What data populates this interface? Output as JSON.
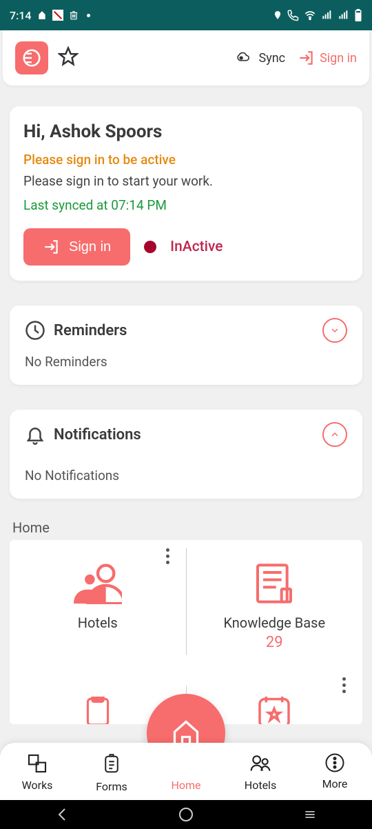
{
  "status": {
    "time": "7:14"
  },
  "header": {
    "sync_label": "Sync",
    "signin_label": "Sign in"
  },
  "greeting_card": {
    "greeting": "Hi, Ashok Spoors",
    "active_msg": "Please sign in to be active",
    "work_msg": "Please sign in to start your work.",
    "sync_msg": "Last synced at  07:14 PM",
    "signin_btn": "Sign in",
    "inactive_label": "InActive"
  },
  "reminders": {
    "title": "Reminders",
    "body": "No Reminders"
  },
  "notifications": {
    "title": "Notifications",
    "body": "No Notifications"
  },
  "home": {
    "label": "Home",
    "tiles": [
      {
        "label": "Hotels"
      },
      {
        "label": "Knowledge Base",
        "count": "29"
      }
    ]
  },
  "nav": {
    "items": [
      {
        "label": "Works"
      },
      {
        "label": "Forms"
      },
      {
        "label": "Home"
      },
      {
        "label": "Hotels"
      },
      {
        "label": "More"
      }
    ]
  }
}
